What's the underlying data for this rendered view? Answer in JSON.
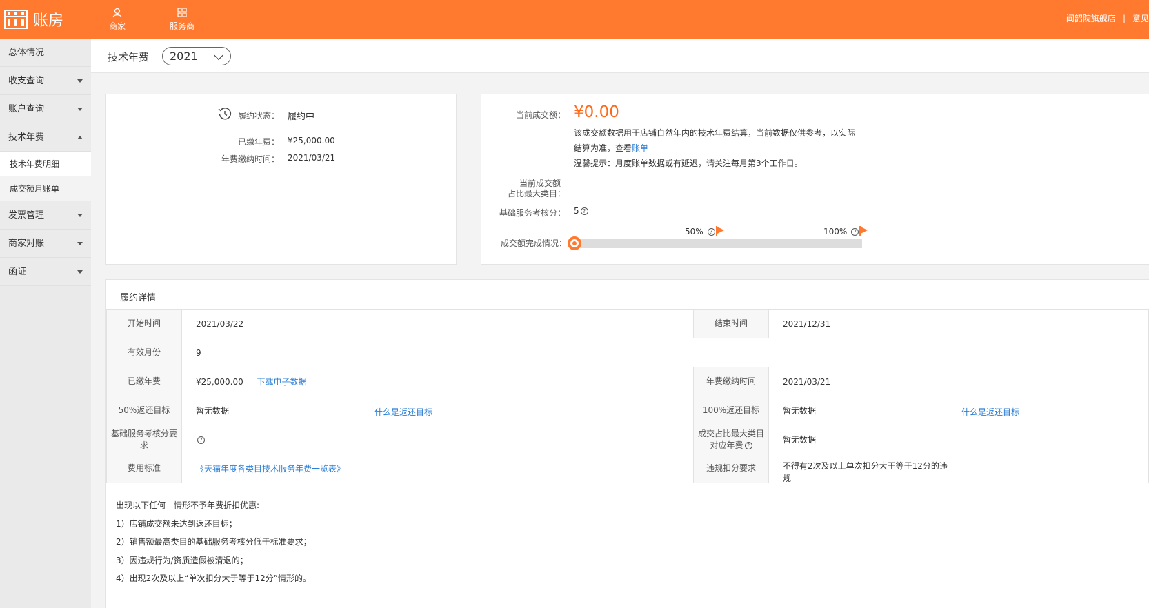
{
  "header": {
    "app_title": "账房",
    "nav": [
      {
        "label": "商家",
        "icon": "user-icon"
      },
      {
        "label": "服务商",
        "icon": "grid-icon"
      }
    ],
    "shop_name": "闻韶院旗舰店",
    "separator": "|",
    "feedback_label": "意见"
  },
  "sidebar": {
    "items": [
      {
        "label": "总体情况",
        "has_caret": false
      },
      {
        "label": "收支查询",
        "has_caret": true
      },
      {
        "label": "账户查询",
        "has_caret": true
      },
      {
        "label": "技术年费",
        "has_caret": true,
        "expanded": true
      },
      {
        "label": "技术年费明细",
        "sub": true,
        "active": true
      },
      {
        "label": "成交额月账单",
        "sub": true
      },
      {
        "label": "发票管理",
        "has_caret": true
      },
      {
        "label": "商家对账",
        "has_caret": true
      },
      {
        "label": "函证",
        "has_caret": true
      }
    ]
  },
  "subheader": {
    "title": "技术年费",
    "year": "2021"
  },
  "status_panel": {
    "status_label": "履约状态：",
    "status_value": "履约中",
    "paid_label": "已缴年费：",
    "paid_value": "¥25,000.00",
    "paid_time_label": "年费缴纳时间：",
    "paid_time_value": "2021/03/21"
  },
  "turnover_panel": {
    "current_label": "当前成交额：",
    "current_value": "¥0.00",
    "desc_line1": "该成交额数据用于店铺自然年内的技术年费结算，当前数据仅供参考，以实际",
    "desc_line2_prefix": "结算为准，查看",
    "desc_link": "账单",
    "desc_line3": "温馨提示：月度账单数据或有延迟，请关注每月第3个工作日。",
    "top_category_label_1": "当前成交额",
    "top_category_label_2": "占比最大类目：",
    "service_score_label": "基础服务考核分：",
    "service_score_value": "5",
    "progress_label": "成交额完成情况：",
    "progress_value": 0,
    "marker_50": "50%",
    "marker_100": "100%"
  },
  "detail": {
    "title": "履约详情",
    "start_label": "开始时间",
    "start_value": "2021/03/22",
    "end_label": "结束时间",
    "end_value": "2021/12/31",
    "months_label": "有效月份",
    "months_value": "9",
    "paid_label": "已缴年费",
    "paid_value": "¥25,000.00",
    "download_link": "下载电子数据",
    "paid_time_label": "年费缴纳时间",
    "paid_time_value": "2021/03/21",
    "target50_label": "50%返还目标",
    "target50_value": "暂无数据",
    "target50_link": "什么是返还目标",
    "target100_label": "100%返还目标",
    "target100_value": "暂无数据",
    "target100_link": "什么是返还目标",
    "score_req_label": "基础服务考核分要求",
    "topcat_fee_label": "成交占比最大类目对应年费",
    "topcat_fee_value": "暂无数据",
    "fee_std_label": "费用标准",
    "fee_std_link": "《天猫年度各类目技术服务年费一览表》",
    "violation_label": "违规扣分要求",
    "violation_value": "不得有2次及以上单次扣分大于等于12分的违规"
  },
  "terms": {
    "intro": "出现以下任何一情形不予年费折扣优惠:",
    "items": [
      "1）店铺成交额未达到返还目标；",
      "2）销售额最高类目的基础服务考核分低于标准要求；",
      "3）因违规行为/资质造假被清退的；",
      "4）出现2次及以上“单次扣分大于等于12分”情形的。"
    ]
  }
}
